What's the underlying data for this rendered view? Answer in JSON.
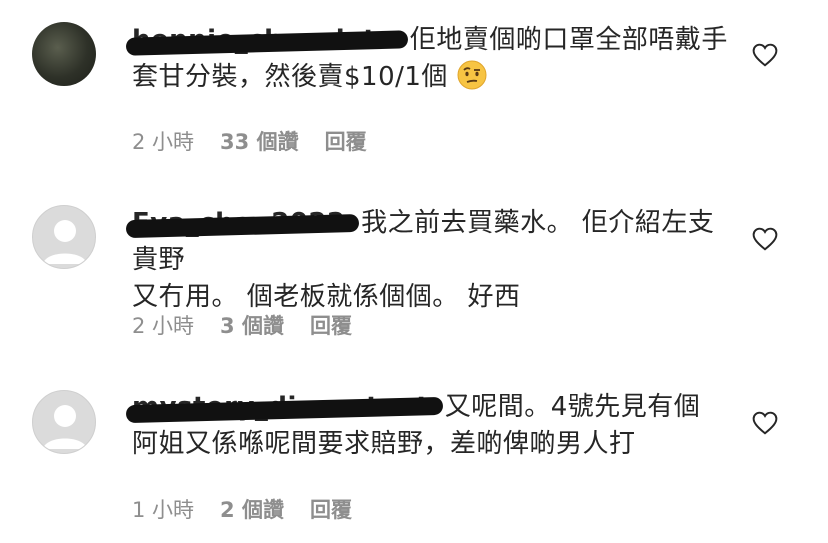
{
  "comments": [
    {
      "username": "hennie_chocolate",
      "text_line1": "佢地賣個啲口罩全部唔戴手",
      "text_line2": "套甘分裝，然後賣$10/1個",
      "emoji": "face-with-raised-eyebrow",
      "time": "2 小時",
      "likes": "33 個讚",
      "reply": "回覆"
    },
    {
      "username": "Eva_chan2022",
      "text_line1": "我之前去買藥水。 佢介紹左支貴野",
      "text_line2": "又冇用。 個老板就係個個。 好西",
      "time": "2 小時",
      "likes": "3 個讚",
      "reply": "回覆"
    },
    {
      "username": "mystery_discontent",
      "text_line1": "又呢間。4號先見有個",
      "text_line2": "阿姐又係喺呢間要求賠野，差啲俾啲男人打",
      "time": "1 小時",
      "likes": "2 個讚",
      "reply": "回覆"
    }
  ],
  "icons": {
    "like": "heart-outline-icon",
    "avatar": "default-avatar-icon"
  },
  "colors": {
    "text": "#262626",
    "meta": "#8e8e8e",
    "avatar_bg": "#dbdbdb"
  }
}
